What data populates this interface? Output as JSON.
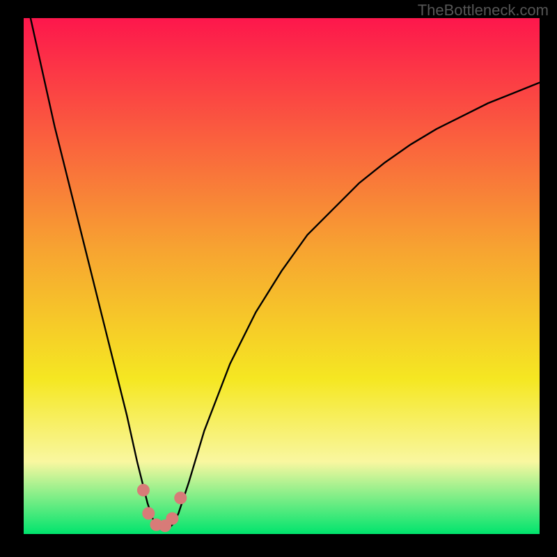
{
  "watermark": "TheBottleneck.com",
  "colors": {
    "background": "#000000",
    "gradient_top": "#fd174c",
    "gradient_mid1": "#f7a431",
    "gradient_mid2": "#f5e722",
    "gradient_mid3": "#f9f7a0",
    "gradient_bottom": "#00e46d",
    "curve": "#000000",
    "markers_fill": "#d87b78",
    "markers_stroke": "#d87b78"
  },
  "chart_data": {
    "type": "line",
    "title": "",
    "xlabel": "",
    "ylabel": "",
    "xlim": [
      0,
      100
    ],
    "ylim": [
      0,
      100
    ],
    "grid": false,
    "legend": false,
    "series": [
      {
        "name": "bottleneck-curve",
        "x": [
          0,
          2,
          4,
          6,
          8,
          10,
          12,
          14,
          16,
          18,
          20,
          22,
          23,
          24,
          25,
          26,
          27,
          28,
          29,
          30,
          32,
          35,
          40,
          45,
          50,
          55,
          60,
          65,
          70,
          75,
          80,
          85,
          90,
          95,
          100
        ],
        "y": [
          106,
          97,
          88,
          79,
          71,
          63,
          55,
          47,
          39,
          31,
          23,
          14,
          10,
          6,
          3,
          1.5,
          1,
          1,
          2,
          4,
          10,
          20,
          33,
          43,
          51,
          58,
          63,
          68,
          72,
          75.5,
          78.5,
          81,
          83.5,
          85.5,
          87.5
        ]
      }
    ],
    "markers": {
      "name": "trough-markers",
      "x": [
        23.2,
        24.2,
        25.7,
        27.4,
        28.8,
        30.4
      ],
      "y": [
        8.5,
        4.0,
        1.8,
        1.6,
        3.0,
        7.0
      ]
    },
    "annotations": []
  }
}
